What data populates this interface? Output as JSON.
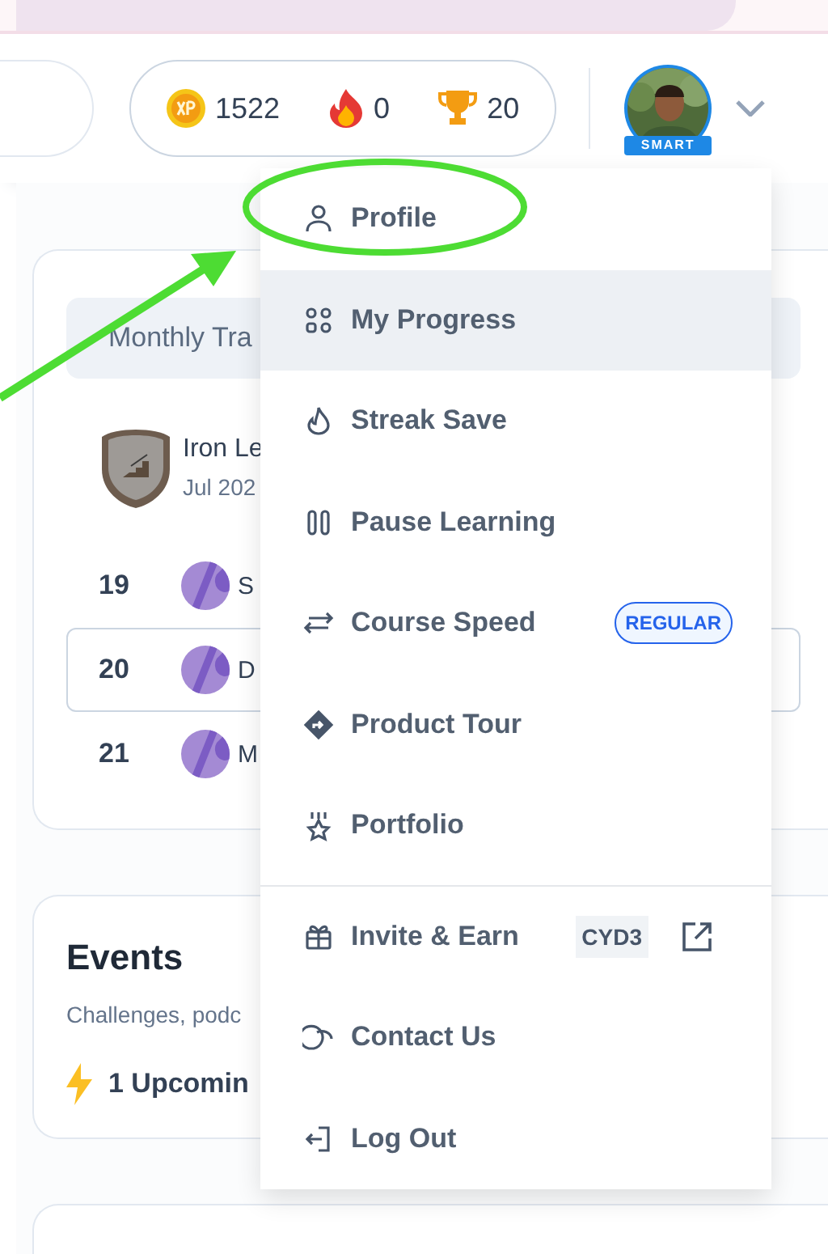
{
  "header": {
    "stats": [
      {
        "kind": "xp",
        "value": "1522"
      },
      {
        "kind": "streak",
        "value": "0"
      },
      {
        "kind": "trophy",
        "value": "20"
      }
    ],
    "avatar_ribbon": "SMART"
  },
  "leaderboard": {
    "tab": "Monthly Tra",
    "league": {
      "name": "Iron Le",
      "date": "Jul 202"
    },
    "rows": [
      {
        "rank": "19",
        "name": "S",
        "selected": false
      },
      {
        "rank": "20",
        "name": "D",
        "selected": true
      },
      {
        "rank": "21",
        "name": "M",
        "selected": false
      }
    ]
  },
  "events": {
    "title": "Events",
    "subtitle": "Challenges, podc",
    "upcoming": "1 Upcomin"
  },
  "menu": {
    "items": [
      {
        "label": "Profile",
        "selected": false
      },
      {
        "label": "My Progress",
        "selected": true
      },
      {
        "label": "Streak Save",
        "selected": false
      },
      {
        "label": "Pause Learning",
        "selected": false
      },
      {
        "label": "Course Speed",
        "selected": false,
        "badge": "REGULAR"
      },
      {
        "label": "Product Tour",
        "selected": false
      },
      {
        "label": "Portfolio",
        "selected": false
      },
      {
        "label": "Invite & Earn",
        "selected": false,
        "code": "CYD3",
        "divider_before": true
      },
      {
        "label": "Contact Us",
        "selected": false
      },
      {
        "label": "Log Out",
        "selected": false
      }
    ]
  }
}
